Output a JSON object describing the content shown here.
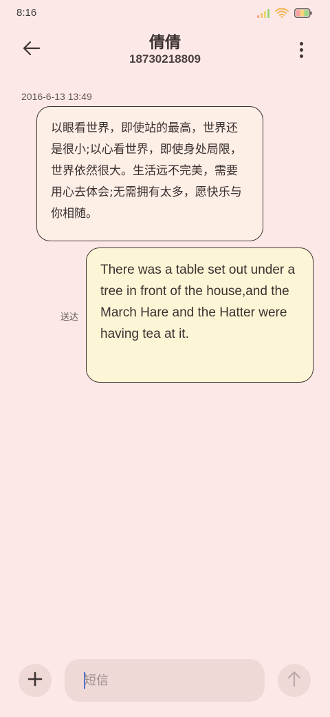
{
  "status_bar": {
    "time": "8:16",
    "icons": [
      "signal-icon",
      "wifi-icon",
      "battery-icon"
    ],
    "signal_colors": [
      "#f6a28a",
      "#f6c27a",
      "#e8d870",
      "#9ad27a"
    ],
    "wifi_color": "#f5b24f",
    "battery_colors": [
      "#f6a1a1",
      "#f7d27a",
      "#9fd68a"
    ]
  },
  "header": {
    "contact_name": "倩倩",
    "contact_number": "18730218809",
    "back_icon": "back-arrow-icon",
    "more_icon": "more-vertical-icon"
  },
  "conversation": {
    "timestamp": "2016-6-13 13:49",
    "incoming": {
      "text": "以眼看世界，即使站的最高，世界还是很小;以心看世界，即使身处局限，世界依然很大。生活远不完美，需要用心去体会;无需拥有太多，愿快乐与你相随。"
    },
    "outgoing": {
      "text": "There was a table set out under a tree in front of the house,and the March Hare and the Hatter were having tea at it.",
      "status": "送达"
    }
  },
  "composer": {
    "add_icon": "plus-icon",
    "placeholder": "短信",
    "value": "",
    "send_icon": "arrow-up-icon"
  },
  "colors": {
    "background": "#fce9e7",
    "incoming_bubble": "#fdeee6",
    "outgoing_bubble": "#fdf6d6",
    "control_fill": "#efd9d7",
    "caret": "#4a6cd8"
  }
}
